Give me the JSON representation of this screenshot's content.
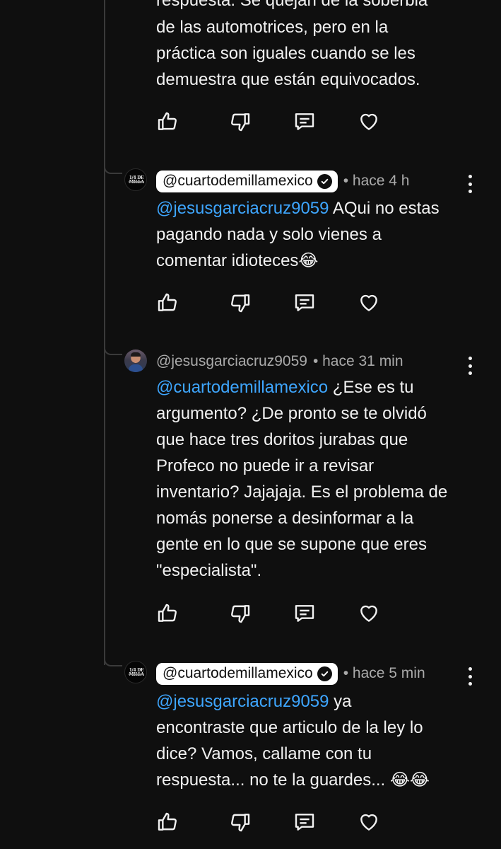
{
  "colors": {
    "background": "#0f0f0f",
    "text": "#f1f1f1",
    "muted": "#aaaaaa",
    "mention": "#3ea6ff",
    "pill": "#ffffff"
  },
  "top_comment": {
    "partial_line": "respuesta. Se quejan de la soberbia",
    "text": "de las automotrices, pero en la\npráctica son iguales cuando se les\ndemuestra que están equivocados."
  },
  "replies": [
    {
      "author": "@cuartodemillamexico",
      "verified": true,
      "time": "• hace 4 h",
      "mention": "@jesusgarciacruz9059",
      "text": " AQui no estas\npagando nada y solo vienes a\ncomentar idioteces😂"
    },
    {
      "author": "@jesusgarciacruz9059",
      "verified": false,
      "time": "• hace 31 min",
      "mention": "@cuartodemillamexico",
      "text": " ¿Ese es tu\nargumento? ¿De pronto se te olvidó\nque hace tres doritos jurabas que\nProfeco no puede ir a revisar\ninventario? Jajajaja. Es el problema de\nnomás ponerse a desinformar a la\ngente en lo que se supone que eres\n\"especialista\"."
    },
    {
      "author": "@cuartodemillamexico",
      "verified": true,
      "time": "• hace 5 min",
      "mention": "@jesusgarciacruz9059",
      "text": " ya\nencontraste que articulo de la ley lo\ndice? Vamos, callame con tu\nrespuesta... no te la guardes... 😂😂"
    }
  ],
  "brand_avatar_text": "1/4 DE MILLA",
  "icons": {
    "like": "thumbs-up-icon",
    "dislike": "thumbs-down-icon",
    "reply": "reply-comment-icon",
    "heart": "heart-icon",
    "more": "more-vert-icon"
  }
}
